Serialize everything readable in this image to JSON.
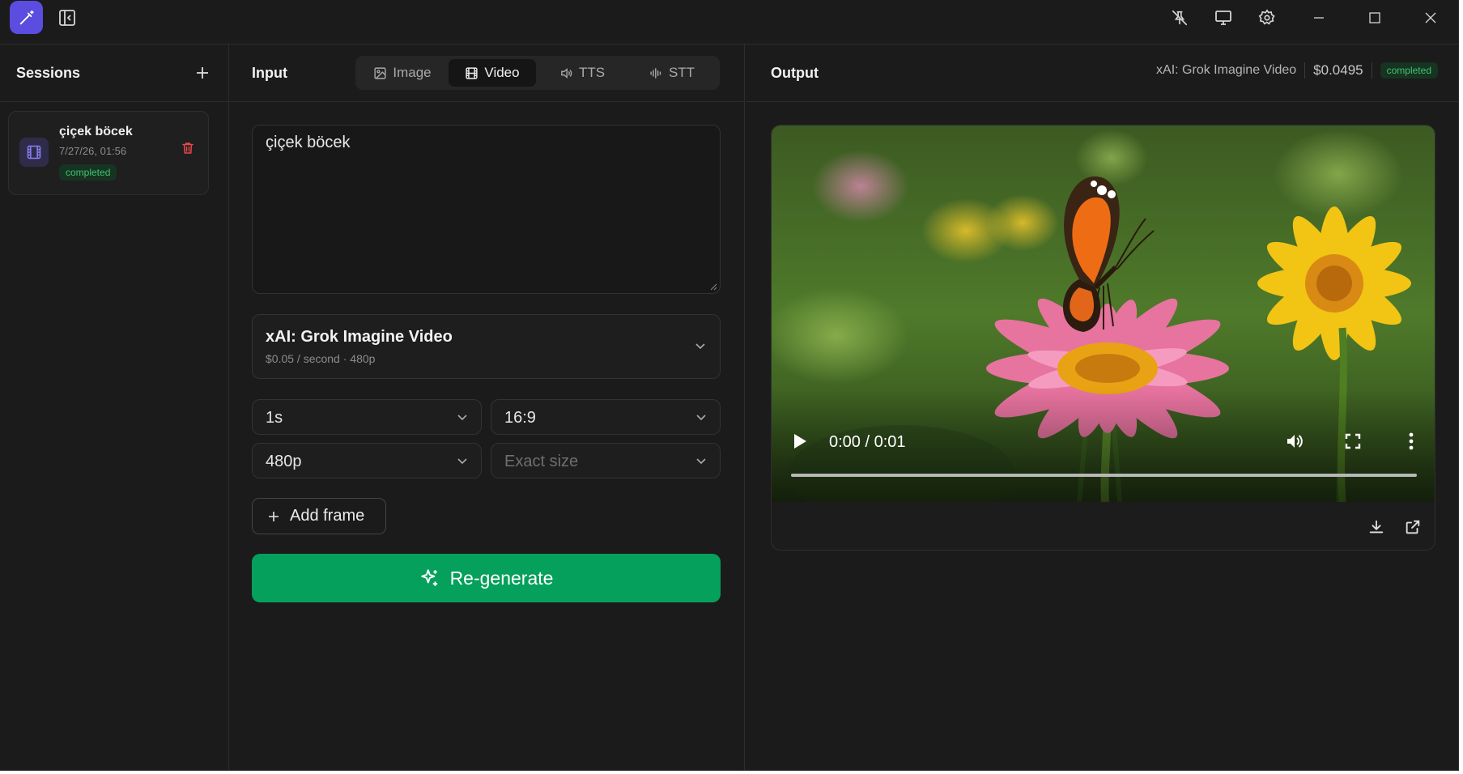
{
  "titlebar": {
    "icons": [
      "magic-wand-icon",
      "collapse-sidebar-icon",
      "unpin-icon",
      "monitor-icon",
      "gear-icon",
      "minimize-icon",
      "maximize-icon",
      "close-icon"
    ]
  },
  "sidebar": {
    "title": "Sessions",
    "sessions": [
      {
        "name": "çiçek böcek",
        "date": "7/27/26, 01:56",
        "status": "completed",
        "icon": "film-icon"
      }
    ]
  },
  "input": {
    "title": "Input",
    "tabs": [
      {
        "label": "Image",
        "icon": "image-icon",
        "active": false
      },
      {
        "label": "Video",
        "icon": "film-icon",
        "active": true
      },
      {
        "label": "TTS",
        "icon": "speaker-icon",
        "active": false
      },
      {
        "label": "STT",
        "icon": "waveform-icon",
        "active": false
      }
    ],
    "prompt": "çiçek böcek",
    "model": {
      "name": "xAI: Grok Imagine Video",
      "sub": "$0.05 / second · 480p"
    },
    "options": {
      "duration": "1s",
      "aspect": "16:9",
      "resolution": "480p",
      "size_placeholder": "Exact size"
    },
    "add_frame": "Add frame",
    "regenerate": "Re-generate"
  },
  "output": {
    "title": "Output",
    "model": "xAI: Grok Imagine Video",
    "price": "$0.0495",
    "status": "completed",
    "video": {
      "time": "0:00 / 0:01",
      "progress": 0
    }
  },
  "colors": {
    "accent": "#5b4de0",
    "primary_button": "#05a05c",
    "status_green": "#3fc46e",
    "danger": "#e5484d"
  }
}
